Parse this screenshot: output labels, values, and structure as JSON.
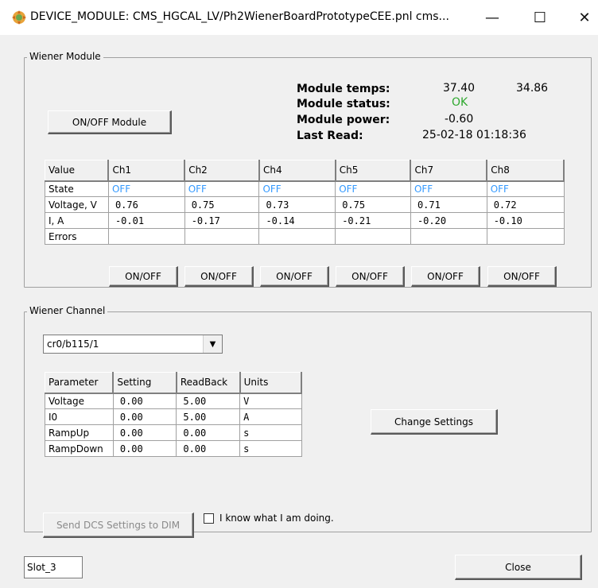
{
  "window": {
    "title": "DEVICE_MODULE: CMS_HGCAL_LV/Ph2WienerBoardPrototypeCEE.pnl cms...",
    "minimize_glyph": "—",
    "maximize_glyph": "☐",
    "close_glyph": "✕",
    "icon": "panel-app-icon"
  },
  "module_group": {
    "legend": "Wiener Module",
    "onoff_button": "ON/OFF Module",
    "info": {
      "temps_label": "Module temps:",
      "temp1": "37.40",
      "temp2": "34.86",
      "status_label": "Module status:",
      "status": "OK",
      "power_label": "Module power:",
      "power": "-0.60",
      "last_read_label": "Last Read:",
      "last_read": "25-02-18 01:18:36"
    },
    "table": {
      "headers": [
        "Value",
        "Ch1",
        "Ch2",
        "Ch4",
        "Ch5",
        "Ch7",
        "Ch8"
      ],
      "rows": [
        {
          "label": "State",
          "cells": [
            "OFF",
            "OFF",
            "OFF",
            "OFF",
            "OFF",
            "OFF"
          ]
        },
        {
          "label": "Voltage, V",
          "cells": [
            "0.76",
            "0.75",
            "0.73",
            "0.75",
            "0.71",
            "0.72"
          ]
        },
        {
          "label": "I, A",
          "cells": [
            "-0.01",
            "-0.17",
            "-0.14",
            "-0.21",
            "-0.20",
            "-0.10"
          ]
        },
        {
          "label": "Errors",
          "cells": [
            "",
            "",
            "",
            "",
            "",
            ""
          ]
        }
      ]
    },
    "channel_buttons": [
      "ON/OFF",
      "ON/OFF",
      "ON/OFF",
      "ON/OFF",
      "ON/OFF",
      "ON/OFF"
    ]
  },
  "channel_group": {
    "legend": "Wiener Channel",
    "selected_channel": "cr0/b115/1",
    "table": {
      "headers": [
        "Parameter",
        "Setting",
        "ReadBack",
        "Units"
      ],
      "rows": [
        [
          "Voltage",
          "0.00",
          "5.00",
          "V"
        ],
        [
          "I0",
          "0.00",
          "5.00",
          "A"
        ],
        [
          "RampUp",
          "0.00",
          "0.00",
          "s"
        ],
        [
          "RampDown",
          "0.00",
          "0.00",
          "s"
        ]
      ]
    },
    "change_settings": "Change Settings",
    "send_dcs": "Send DCS Settings to DIM",
    "checkbox_label": "I know what I am doing.",
    "checkbox_checked": false
  },
  "footer": {
    "slot": "Slot_3",
    "close": "Close"
  },
  "colors": {
    "status_ok": "#2ea82e",
    "state_off": "#3399ff"
  }
}
